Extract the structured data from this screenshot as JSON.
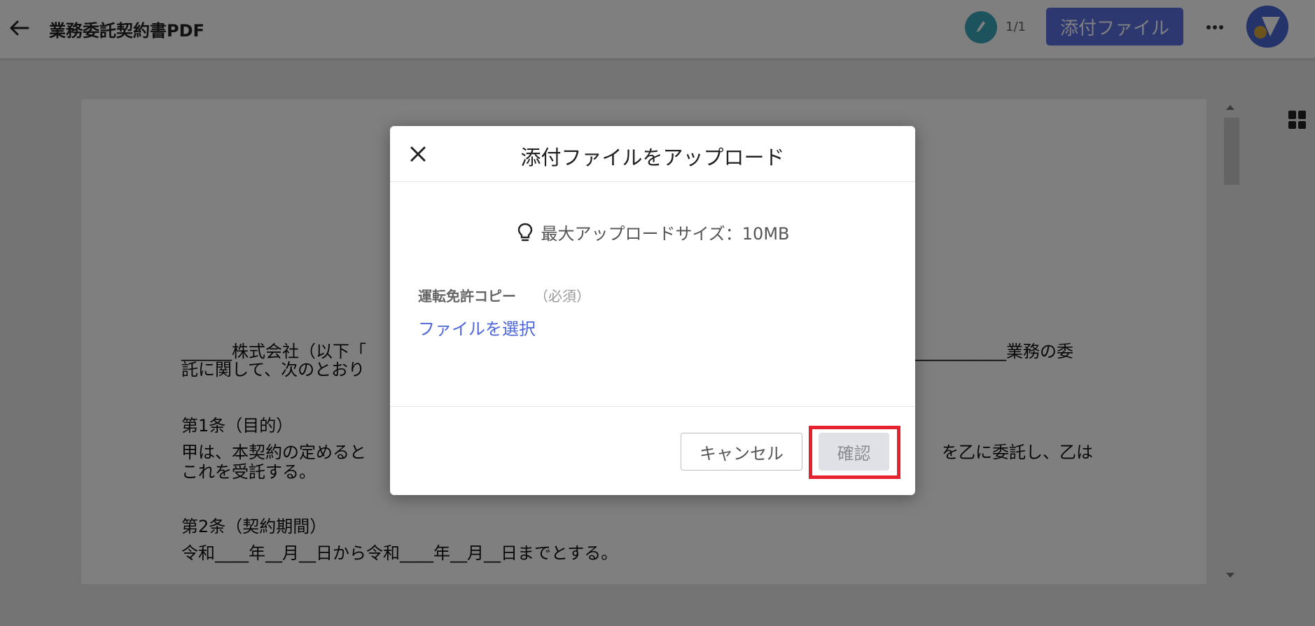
{
  "header": {
    "back_icon": "arrow-left-icon",
    "title": "業務委託契約書PDF",
    "signer_icon": "pen-icon",
    "page_indicator": "1/1",
    "attach_button": "添付ファイル",
    "more_icon": "more-horizontal-icon",
    "brand_color": "#5a6fe0"
  },
  "document": {
    "paragraphs": [
      "______株式会社（以下「",
      "託に関して、次のとおり",
      "第1条（目的）",
      "甲は、本契約の定めると",
      "これを受託する。",
      "第2条（契約期間）",
      "令和____年__月__日から令和____年__月__日までとする。"
    ],
    "right_fragments": [
      "___________業務の委",
      "を乙に委託し、乙は"
    ]
  },
  "modal": {
    "close_icon": "close-icon",
    "title": "添付ファイルをアップロード",
    "size_icon": "lightbulb-icon",
    "size_info": "最大アップロードサイズ：10MB",
    "field_label": "運転免許コピー",
    "field_required": "（必須）",
    "file_select": "ファイルを選択",
    "cancel_button": "キャンセル",
    "confirm_button": "確認",
    "highlight_color": "#e5222e"
  }
}
